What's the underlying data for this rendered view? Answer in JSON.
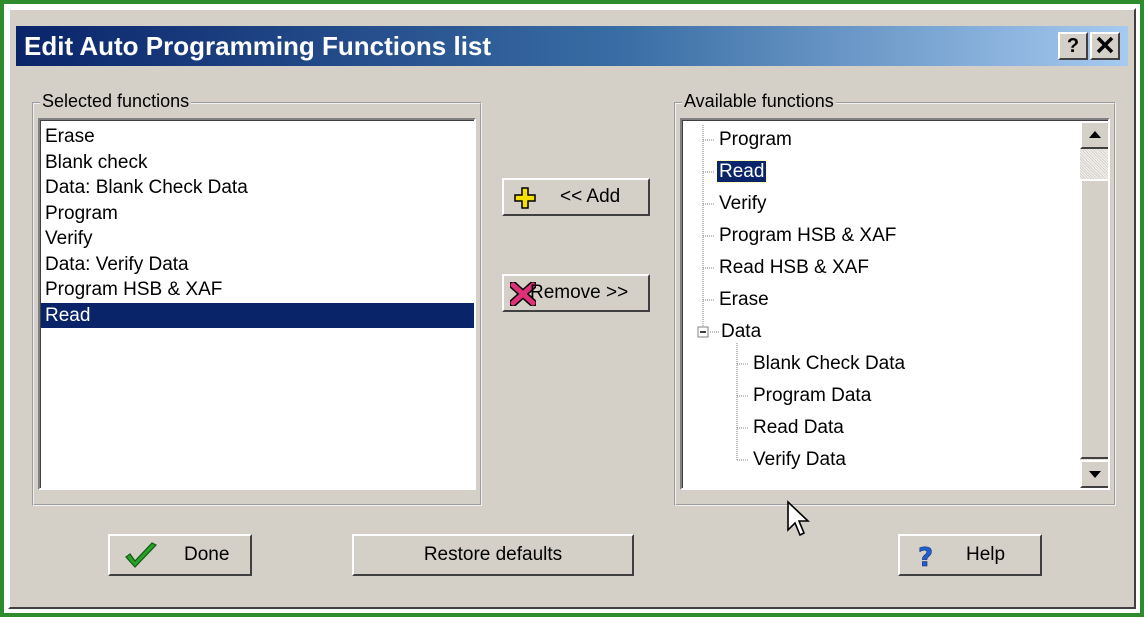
{
  "window": {
    "title": "Edit Auto Programming Functions list",
    "help_button": "?",
    "close_button": "×"
  },
  "selected_group": {
    "label": "Selected functions",
    "items": [
      {
        "label": "Erase",
        "selected": false
      },
      {
        "label": "Blank check",
        "selected": false
      },
      {
        "label": "Data:  Blank Check Data",
        "selected": false
      },
      {
        "label": "Program",
        "selected": false
      },
      {
        "label": "Verify",
        "selected": false
      },
      {
        "label": "Data:  Verify Data",
        "selected": false
      },
      {
        "label": "Program HSB & XAF",
        "selected": false
      },
      {
        "label": "Read",
        "selected": true
      }
    ]
  },
  "available_group": {
    "label": "Available functions",
    "tree": [
      {
        "label": "Program",
        "selected": false
      },
      {
        "label": "Read",
        "selected": true
      },
      {
        "label": "Verify",
        "selected": false
      },
      {
        "label": "Program HSB & XAF",
        "selected": false
      },
      {
        "label": "Read HSB & XAF",
        "selected": false
      },
      {
        "label": "Erase",
        "selected": false
      },
      {
        "label": "Data",
        "expanded": true,
        "toggle": "−"
      },
      {
        "label": "Blank Check Data",
        "selected": false
      },
      {
        "label": "Program Data",
        "selected": false
      },
      {
        "label": "Read Data",
        "selected": false
      },
      {
        "label": "Verify Data",
        "selected": false
      }
    ]
  },
  "actions": {
    "add_label": "<< Add",
    "remove_label": "Remove >>"
  },
  "footer": {
    "done_label": "Done",
    "restore_label": "Restore defaults",
    "help_label": "Help"
  },
  "colors": {
    "title_gradient_start": "#0a246a",
    "selection": "#0a246a",
    "frame_green": "#2e8b2e",
    "add_icon": "#f5e000",
    "remove_icon": "#e0307a",
    "done_check": "#2aa02a",
    "help_icon": "#1f5fd0"
  }
}
